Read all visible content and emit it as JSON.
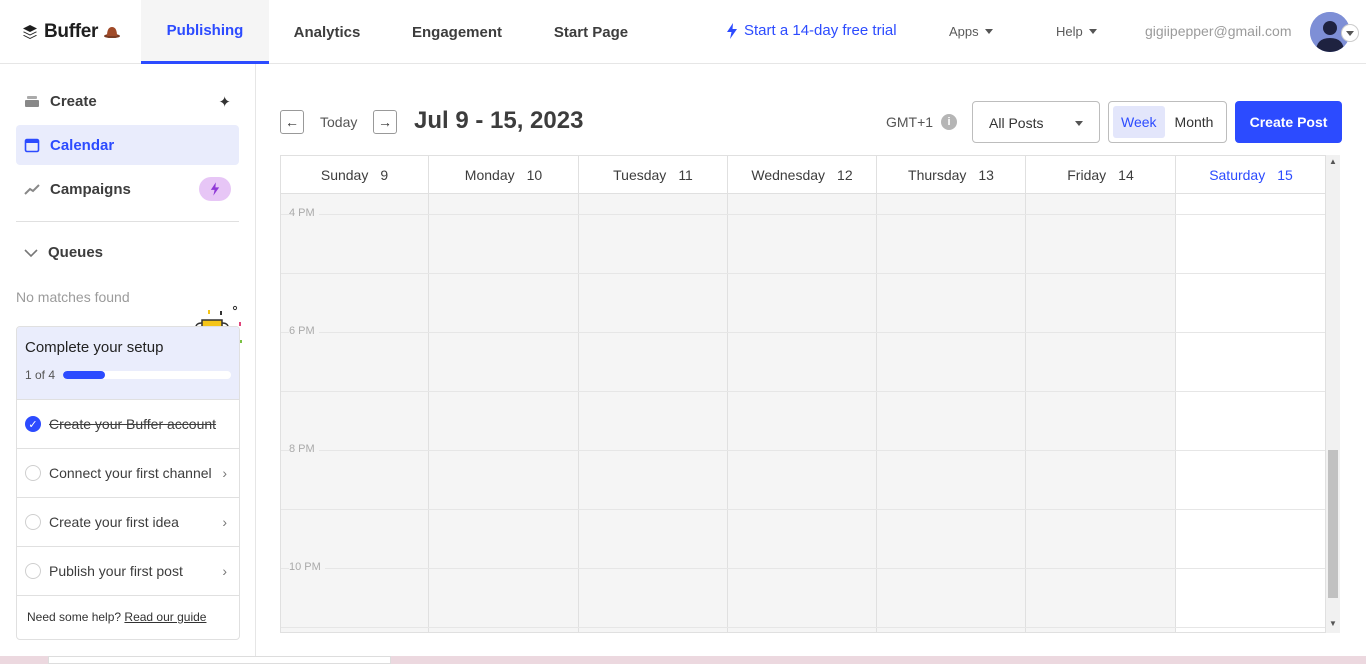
{
  "brand": {
    "name": "Buffer",
    "accent": "#2c4bff"
  },
  "nav": {
    "tabs": [
      {
        "label": "Publishing",
        "active": true
      },
      {
        "label": "Analytics",
        "active": false
      },
      {
        "label": "Engagement",
        "active": false
      },
      {
        "label": "Start Page",
        "active": false
      }
    ],
    "trial": "Start a 14-day free trial",
    "apps": "Apps",
    "help": "Help",
    "email": "gigiipepper@gmail.com"
  },
  "sidebar": {
    "create": "Create",
    "calendar": "Calendar",
    "campaigns": "Campaigns",
    "queues": "Queues",
    "no_matches": "No matches found",
    "setup": {
      "title": "Complete your setup",
      "progress_text": "1 of 4",
      "progress": 0.25,
      "steps": [
        {
          "label": "Create your Buffer account",
          "done": true
        },
        {
          "label": "Connect your first channel",
          "done": false
        },
        {
          "label": "Create your first idea",
          "done": false
        },
        {
          "label": "Publish your first post",
          "done": false
        }
      ],
      "help_prefix": "Need some help?",
      "help_link": "Read our guide"
    }
  },
  "toolbar": {
    "today": "Today",
    "range": "Jul 9 - 15, 2023",
    "timezone": "GMT+1",
    "filter": "All Posts",
    "view_week": "Week",
    "view_month": "Month",
    "create_post": "Create Post"
  },
  "calendar": {
    "days": [
      {
        "name": "Sunday",
        "num": "9"
      },
      {
        "name": "Monday",
        "num": "10"
      },
      {
        "name": "Tuesday",
        "num": "11"
      },
      {
        "name": "Wednesday",
        "num": "12"
      },
      {
        "name": "Thursday",
        "num": "13"
      },
      {
        "name": "Friday",
        "num": "14"
      },
      {
        "name": "Saturday",
        "num": "15"
      }
    ],
    "hours": [
      "4 PM",
      "6 PM",
      "8 PM",
      "10 PM"
    ]
  }
}
